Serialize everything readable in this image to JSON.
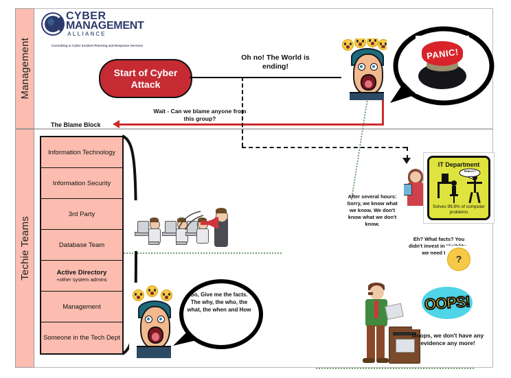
{
  "diagram": {
    "lanes": [
      {
        "id": "management",
        "label": "Management"
      },
      {
        "id": "techie-teams",
        "label": "Techie Teams"
      }
    ],
    "logo": {
      "line1": "CYBER",
      "line2": "MANAGEMENT",
      "line3": "ALLIANCE",
      "tagline": "Consulting in Cyber Incident Planning and Response Services",
      "brand_color": "#2b3a6b"
    },
    "start_node": {
      "label": "Start of Cyber Attack",
      "color": "#c62b34"
    },
    "annotations": {
      "oh_no": "Oh no! The World is ending!",
      "blame_question": "Wait  - Can we blame anyone from this group?",
      "blame_block_label": "The Blame Block",
      "after_hours": "After several hours: Sorry, we know what we know. We don't know what we don't know.",
      "eh_what_facts": "Eh? What facts? You didn't invest in Visiblity - we need time.",
      "oops_caption": "Ooops, we don't have any evidence any more!"
    },
    "speech_bubbles": [
      {
        "id": "panic-bubble",
        "content": "PANIC!"
      },
      {
        "id": "facts-bubble",
        "text": "So, Give me the facts. The why, the who, the what, the when and How"
      }
    ],
    "blame_block": {
      "title": "The Blame Block",
      "rows": [
        {
          "label": "Information Technology",
          "bold": false,
          "sub": ""
        },
        {
          "label": "Information Security",
          "bold": false,
          "sub": ""
        },
        {
          "label": "3rd Party",
          "bold": false,
          "sub": ""
        },
        {
          "label": "Database Team",
          "bold": false,
          "sub": ""
        },
        {
          "label": "Active Directory",
          "bold": true,
          "sub": "+other system admins"
        },
        {
          "label": "Management",
          "bold": false,
          "sub": ""
        },
        {
          "label": "Someone in the Tech Dept",
          "bold": false,
          "sub": ""
        }
      ],
      "fill_color": "#fcbdb0"
    },
    "it_sign": {
      "title": "IT Department",
      "subtitle": "Solves 99.9% of computer problems",
      "bubble": "REBOOT?",
      "color": "#dfe33d"
    },
    "oops_burst": {
      "word": "OOPS!"
    },
    "icons": {
      "scream_face": "screaming-face",
      "shock_emoji": "shocked-face-emoji",
      "think_emoji": "thinking-face-emoji",
      "panic_button": "panic-button",
      "shredder": "paper-shredder",
      "megaphone": "megaphone"
    }
  }
}
